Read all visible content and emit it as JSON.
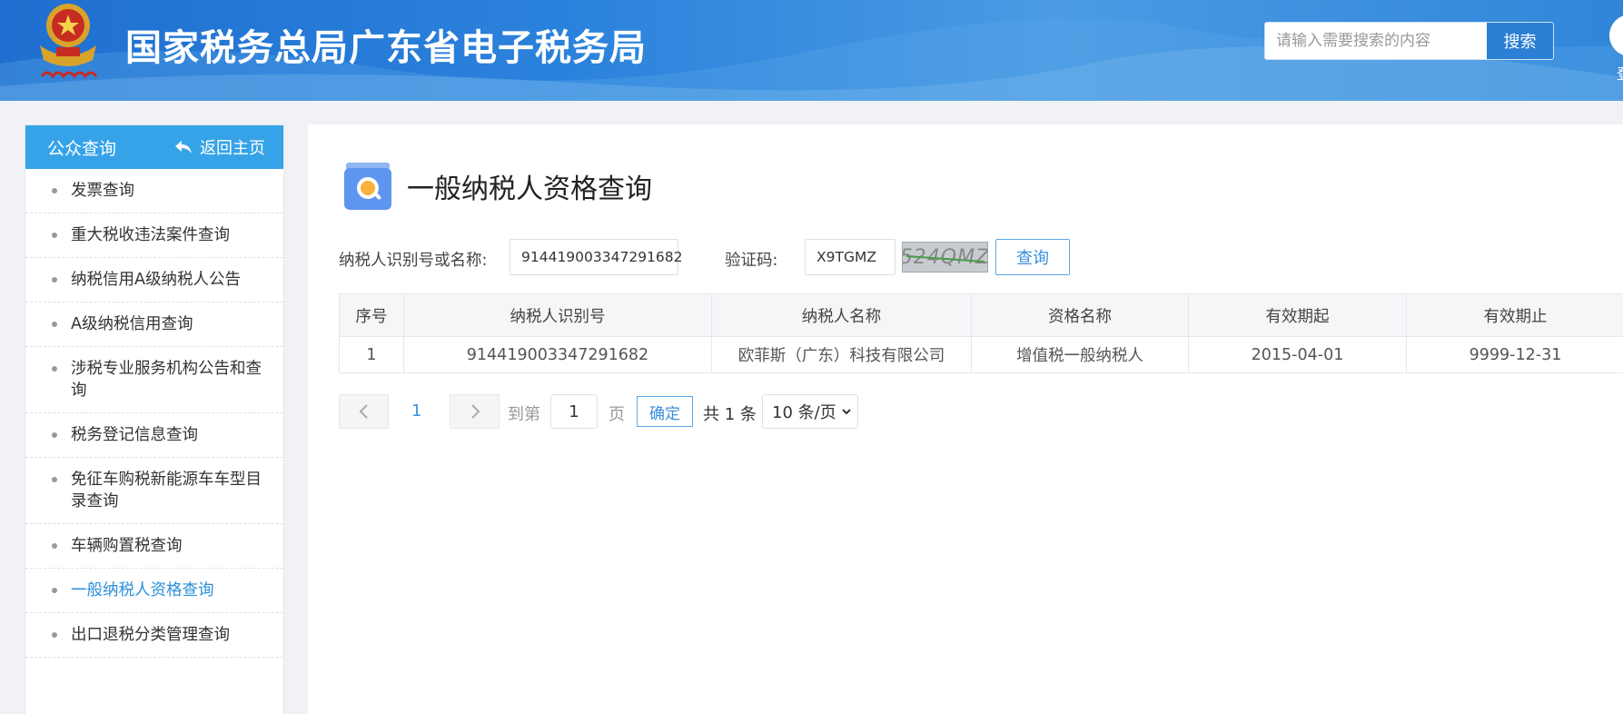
{
  "header": {
    "title": "国家税务总局广东省电子税务局",
    "search_placeholder": "请输入需要搜索的内容",
    "search_button": "搜索",
    "user_label": "登"
  },
  "sidebar": {
    "title": "公众查询",
    "back_label": "返回主页",
    "items": [
      {
        "label": "发票查询"
      },
      {
        "label": "重大税收违法案件查询"
      },
      {
        "label": "纳税信用A级纳税人公告"
      },
      {
        "label": "A级纳税信用查询"
      },
      {
        "label": "涉税专业服务机构公告和查询"
      },
      {
        "label": "税务登记信息查询"
      },
      {
        "label": "免征车购税新能源车车型目录查询"
      },
      {
        "label": "车辆购置税查询"
      },
      {
        "label": "一般纳税人资格查询",
        "active": true
      },
      {
        "label": "出口退税分类管理查询"
      }
    ]
  },
  "main": {
    "page_title": "一般纳税人资格查询",
    "form": {
      "taxpayer_label": "纳税人识别号或名称:",
      "taxpayer_value": "914419003347291682",
      "captcha_label": "验证码:",
      "captcha_value": "X9TGMZ",
      "captcha_image_text": "524QMZ",
      "query_button": "查询"
    },
    "table": {
      "columns": [
        "序号",
        "纳税人识别号",
        "纳税人名称",
        "资格名称",
        "有效期起",
        "有效期止"
      ],
      "rows": [
        [
          "1",
          "914419003347291682",
          "欧菲斯（广东）科技有限公司",
          "增值税一般纳税人",
          "2015-04-01",
          "9999-12-31"
        ]
      ]
    },
    "pager": {
      "prev_icon": "chevron-left-icon",
      "current_page": "1",
      "next_icon": "chevron-right-icon",
      "goto_label": "到第",
      "goto_value": "1",
      "page_unit": "页",
      "confirm": "确定",
      "total": "共 1 条",
      "page_size": "10 条/页"
    }
  },
  "colors": {
    "header_blue": "#2b82dc",
    "sidebar_header": "#36a3e8",
    "link_blue": "#2b8fd8"
  }
}
